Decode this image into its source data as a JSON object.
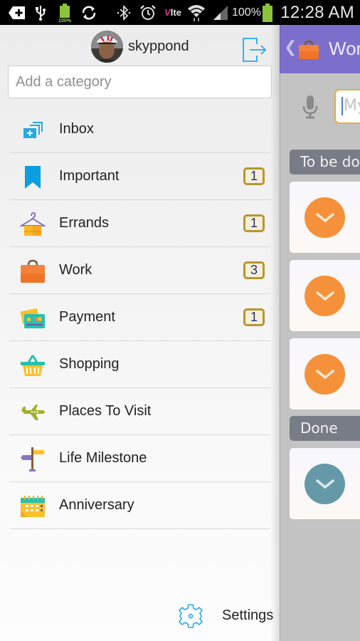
{
  "status_bar": {
    "time": "12:28 AM",
    "battery_percent": "100%",
    "battery_small_label": "100%",
    "icons": [
      "notification-add-icon",
      "usb-icon",
      "battery-full-icon",
      "sync-icon",
      "bluetooth-icon",
      "alarm-icon",
      "volte-icon",
      "wifi-icon",
      "signal-icon",
      "battery-icon"
    ],
    "volte_label": "Vlte"
  },
  "drawer": {
    "username": "skyppond",
    "category_input": {
      "placeholder": "Add a category",
      "value": ""
    },
    "categories": [
      {
        "label": "Inbox",
        "icon": "inbox-icon",
        "badge": null
      },
      {
        "label": "Important",
        "icon": "bookmark-icon",
        "badge": "1"
      },
      {
        "label": "Errands",
        "icon": "hanger-icon",
        "badge": "1"
      },
      {
        "label": "Work",
        "icon": "briefcase-icon",
        "badge": "3"
      },
      {
        "label": "Payment",
        "icon": "credit-card-icon",
        "badge": "1"
      },
      {
        "label": "Shopping",
        "icon": "basket-icon",
        "badge": null
      },
      {
        "label": "Places To Visit",
        "icon": "airplane-icon",
        "badge": null
      },
      {
        "label": "Life Milestone",
        "icon": "signpost-icon",
        "badge": null
      },
      {
        "label": "Anniversary",
        "icon": "calendar-icon",
        "badge": null
      }
    ],
    "settings_label": "Settings"
  },
  "main": {
    "back_glyph": "❮",
    "title": "Work",
    "task_input": {
      "placeholder": "My"
    },
    "sections": [
      {
        "label": "To be done",
        "task_count": 3,
        "color": "#f5913a"
      },
      {
        "label": "Done",
        "task_count": 1,
        "color": "#6699a8"
      }
    ]
  },
  "colors": {
    "header": "#7b6fcb",
    "badge_border": "#b8962e",
    "accent_blue": "#29a9e0",
    "pending": "#f5913a",
    "done": "#6699a8"
  }
}
